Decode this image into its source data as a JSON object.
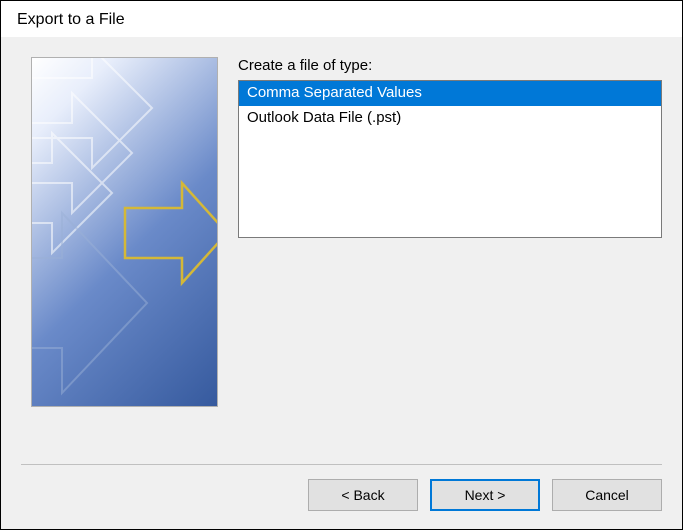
{
  "dialog": {
    "title": "Export to a File",
    "content_label": "Create a file of type:",
    "file_types": [
      {
        "label": "Comma Separated Values",
        "selected": true
      },
      {
        "label": "Outlook Data File (.pst)",
        "selected": false
      }
    ],
    "buttons": {
      "back": "< Back",
      "next": "Next >",
      "cancel": "Cancel"
    }
  }
}
